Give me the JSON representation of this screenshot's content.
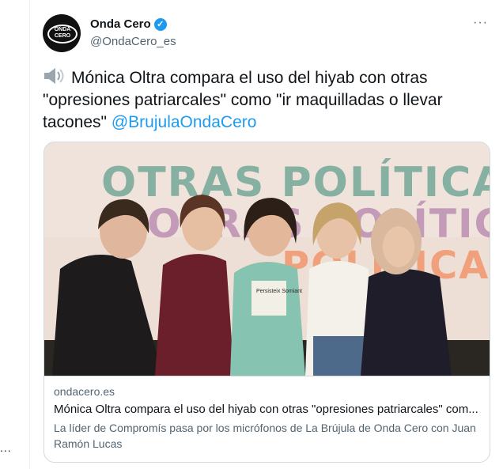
{
  "left": {
    "dots": "..."
  },
  "tweet": {
    "author": {
      "display_name": "Onda Cero",
      "handle": "@OndaCero_es",
      "avatar_text_line1": "ONDA",
      "avatar_text_line2": "CERO",
      "verified_icon": "verified-badge-icon"
    },
    "more_icon": "···",
    "text": {
      "speaker_icon": "speaker-icon",
      "body": "Mónica Oltra compara el uso del hiyab con otras \"opresiones patriarcales\" como \"ir maquilladas o llevar tacones\"",
      "mention": "@BrujulaOndaCero"
    },
    "card": {
      "image_sign_line1": "OTRAS POLÍTICAS",
      "image_sign_line2": "OTRAS POLÍTICAS",
      "image_sign_line3": "POLÍTICAS",
      "shirt_text": "Persisteix Somiant",
      "domain": "ondacero.es",
      "title": "Mónica Oltra compara el uso del hiyab con otras \"opresiones patriarcales\" com...",
      "description": "La líder de Compromís pasa por los micrófonos de La Brújula de Onda Cero con Juan Ramón Lucas"
    }
  },
  "colors": {
    "accent": "#1d9bf0",
    "text": "#0f1419",
    "secondary": "#536471",
    "border": "#cfd9de"
  }
}
